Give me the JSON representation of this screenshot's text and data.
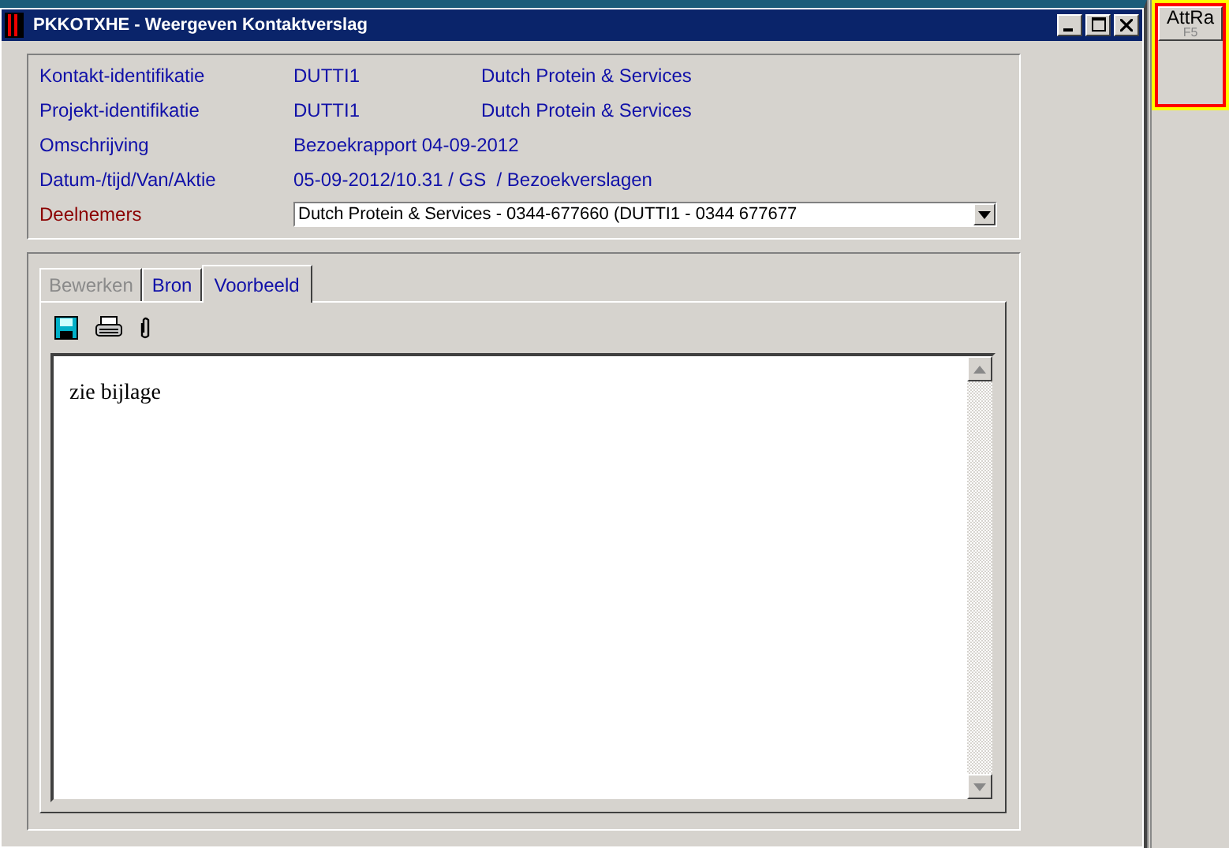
{
  "window": {
    "title": "PKKOTXHE - Weergeven Kontaktverslag"
  },
  "fields": [
    {
      "label": "Kontakt-identifikatie",
      "value": "DUTTI1",
      "extra": "Dutch Protein & Services"
    },
    {
      "label": "Projekt-identifikatie",
      "value": "DUTTI1",
      "extra": "Dutch Protein & Services"
    },
    {
      "label": "Omschrijving",
      "value": "Bezoekrapport 04-09-2012"
    },
    {
      "label": "Datum-/tijd/Van/Aktie",
      "value": "05-09-2012/10.31 / GS  / Bezoekverslagen"
    }
  ],
  "participants": {
    "label": "Deelnemers",
    "value": "Dutch Protein & Services - 0344-677660 (DUTTI1 - 0344 677677"
  },
  "tabs": [
    {
      "label": "Bewerken",
      "selected": false,
      "disabled": true
    },
    {
      "label": "Bron",
      "selected": false,
      "disabled": false
    },
    {
      "label": "Voorbeeld",
      "selected": true,
      "disabled": false
    }
  ],
  "editor": {
    "text": "zie bijlage"
  },
  "side_button": {
    "label": "AttRa",
    "shortcut": "F5"
  }
}
